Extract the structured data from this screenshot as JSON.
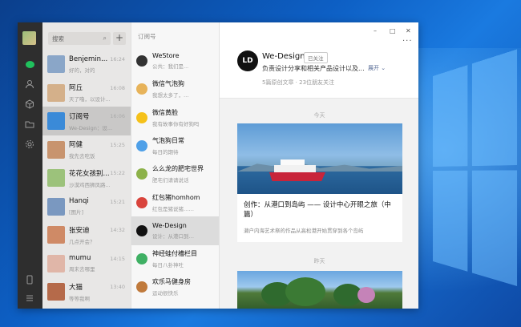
{
  "sidebar_rail": {
    "icons": [
      "avatar",
      "chat-icon",
      "contacts-icon",
      "cube-icon",
      "folder-icon",
      "settings-icon",
      "phone-icon",
      "menu-icon"
    ]
  },
  "chat_list": {
    "search_placeholder": "搜索",
    "add_label": "+",
    "items": [
      {
        "name": "Benjemin...",
        "preview": "好的，对的",
        "time": "16:24",
        "color": "#8aa6c8"
      },
      {
        "name": "阿丘",
        "preview": "天了噜，以设计...",
        "time": "16:08",
        "color": "#d4b08a"
      },
      {
        "name": "订阅号",
        "preview": "We-Design：设...",
        "time": "16:06",
        "color": "#3a8ad8"
      },
      {
        "name": "阿健",
        "preview": "我先去吃饭",
        "time": "15:25",
        "color": "#c8946e"
      },
      {
        "name": "花花女孩别...",
        "preview": "沙漠鸡西狮凤路...",
        "time": "15:22",
        "color": "#9cc27b"
      },
      {
        "name": "Hanqi",
        "preview": "[图片]",
        "time": "15:21",
        "color": "#7a98c0"
      },
      {
        "name": "张安迪",
        "preview": "几点开会？",
        "time": "14:32",
        "color": "#cf8a66"
      },
      {
        "name": "mumu",
        "preview": "周末去哪里",
        "time": "14:15",
        "color": "#e0b6a8"
      },
      {
        "name": "大猫",
        "preview": "等等我啊",
        "time": "13:40",
        "color": "#b56a4a"
      }
    ]
  },
  "subscriptions": {
    "header": "订阅号",
    "items": [
      {
        "name": "WeStore",
        "preview": "公共：我们是...",
        "color": "#333"
      },
      {
        "name": "微信气泡狗",
        "preview": "我想太多了，…",
        "color": "#e7b35a"
      },
      {
        "name": "微信黄脸",
        "preview": "我有故事你有好狗吗",
        "color": "#f5c11a"
      },
      {
        "name": "气泡狗日常",
        "preview": "每日的期待",
        "color": "#4fa0e8"
      },
      {
        "name": "么么龙的肥宅世界",
        "preview": "肥宅们请请说话",
        "color": "#8db24a"
      },
      {
        "name": "红包猪homhom",
        "preview": "红包是猪说猪……",
        "color": "#d9443c"
      },
      {
        "name": "We-Design",
        "preview": "设计：从港口到…",
        "color": "#111"
      },
      {
        "name": "神经蛙付槽栏目",
        "preview": "每日八卦神吐",
        "color": "#3fb064"
      },
      {
        "name": "欢乐马健身房",
        "preview": "运动很快乐",
        "color": "#c07a3c"
      },
      {
        "name": "",
        "preview": "",
        "color": "#a66"
      }
    ]
  },
  "account": {
    "logo_text": "LD",
    "name": "We-Design",
    "follow_label": "已关注",
    "description": "负责设计分享和相关产品设计以及...",
    "expand_label": "展开",
    "stats": "5篇原创文章 · 23位朋友关注",
    "more_label": "···",
    "window_controls": [
      "–",
      "□",
      "✕"
    ]
  },
  "feed": {
    "date_today": "今天",
    "article_title": "创作：从港口到岛屿 —— 设计中心开眼之旅（中篇）",
    "article_summary": "濑户内海艺术祭的作品从高松港开始贯穿到各个岛屿",
    "date_yesterday": "昨天"
  }
}
